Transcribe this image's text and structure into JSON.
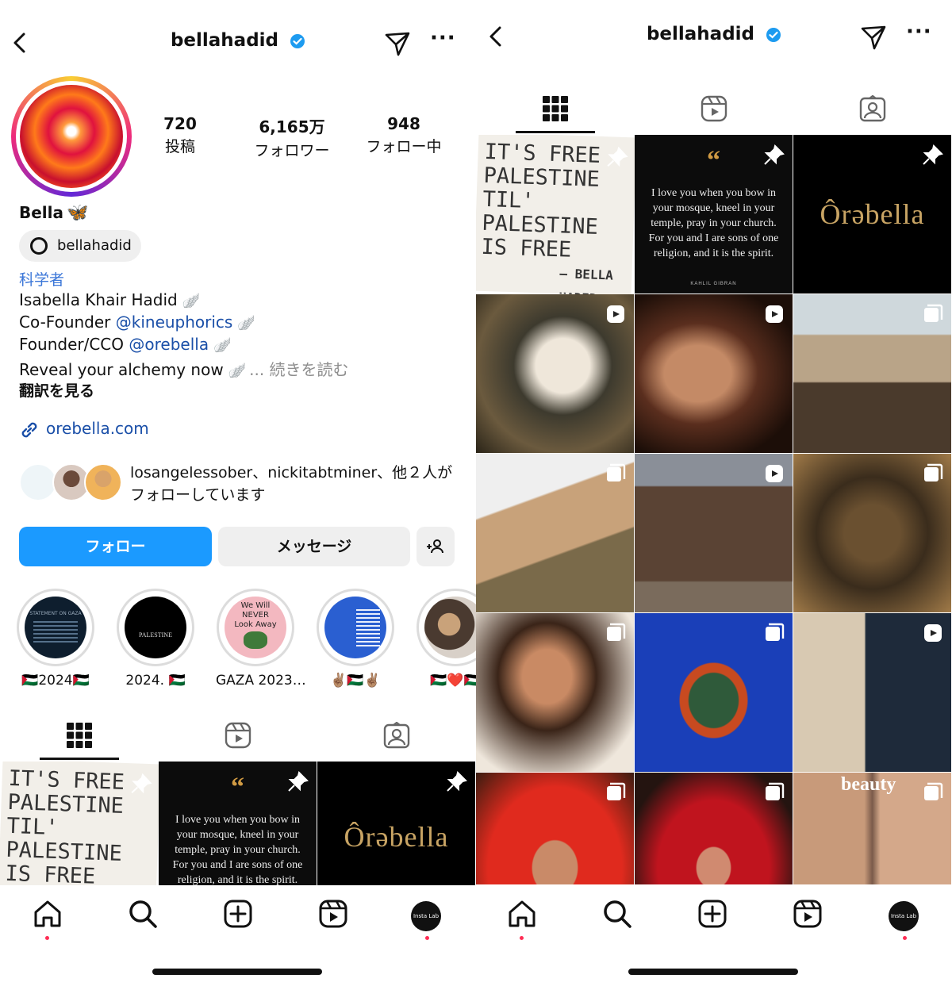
{
  "profile": {
    "username": "bellahadid",
    "stats": [
      {
        "value": "720",
        "label": "投稿"
      },
      {
        "value": "6,165万",
        "label": "フォロワー"
      },
      {
        "value": "948",
        "label": "フォロー中"
      }
    ],
    "name": "Bella",
    "name_emoji": "🦋",
    "threads_handle": "bellahadid",
    "category": "科学者",
    "bio": {
      "line1": "Isabella Khair Hadid",
      "line2_prefix": "Co-Founder ",
      "line2_mention": "@kineuphorics",
      "line3_prefix": "Founder/CCO ",
      "line3_mention": "@orebella",
      "line4": "Reveal your alchemy now",
      "more": "... 続きを読む",
      "wing": "🪽"
    },
    "translate": "翻訳を見る",
    "link": "orebella.com",
    "followed_by": "losangelessober、nickitabtminer、他２人がフォローしています",
    "buttons": {
      "follow": "フォロー",
      "message": "メッセージ",
      "add": "+人"
    },
    "highlights": [
      {
        "label": "🇵🇸2024🇵🇸"
      },
      {
        "label": "2024. 🇵🇸"
      },
      {
        "label": "GAZA 2023…"
      },
      {
        "label": "✌🏽🇵🇸✌🏽"
      },
      {
        "label": "🇵🇸❤️🇵🇸"
      }
    ],
    "hl_text": {
      "h1_title": "STATEMENT ON GAZA",
      "h2_title": "PALESTINE",
      "h3_line1": "We Will",
      "h3_line2": "NEVER",
      "h3_line3": "Look Away"
    }
  },
  "posts": {
    "sign_line1": "IT'S FREE",
    "sign_line2": "PALESTINE",
    "sign_line3": "TIL' PALESTINE",
    "sign_line4": "IS FREE",
    "sign_signoff": "— BELLA HADID",
    "quote_text": "I love you when you bow in your mosque, kneel in your temple, pray in your church. For you and I are sons of one religion, and it is the spirit.",
    "quote_author": "KAHLIL GIBRAN",
    "brand": "Ôrəbella",
    "beauty": "beauty"
  },
  "nav": {
    "avatar_text": "Insta Lab"
  }
}
